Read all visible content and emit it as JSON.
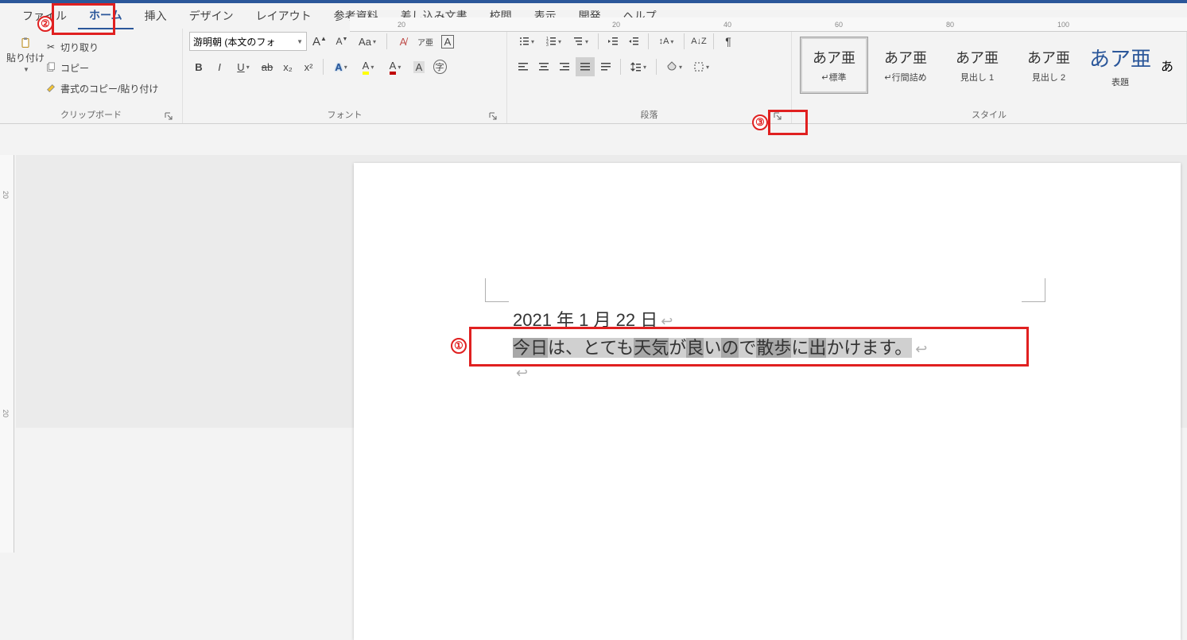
{
  "tabs": {
    "file": "ファイル",
    "home": "ホーム",
    "insert": "挿入",
    "design": "デザイン",
    "layout": "レイアウト",
    "references": "参考資料",
    "mailings": "差し込み文書",
    "review": "校閲",
    "view": "表示",
    "developer": "開発",
    "help": "ヘルプ"
  },
  "clipboard": {
    "paste": "貼り付け",
    "cut": "切り取り",
    "copy": "コピー",
    "format_painter": "書式のコピー/貼り付け",
    "group_label": "クリップボード"
  },
  "font": {
    "name": "游明朝 (本文のフォ",
    "group_label": "フォント",
    "increase": "A",
    "decrease": "A",
    "aa": "Aa",
    "ruby": "ア亜",
    "bold": "B",
    "italic": "I",
    "underline": "U",
    "strike": "ab",
    "sub": "x₂",
    "sup": "x²",
    "text_effects": "A",
    "highlight": "A",
    "font_color": "A",
    "char_shading": "A",
    "enclose": "字"
  },
  "paragraph": {
    "group_label": "段落"
  },
  "styles": {
    "group_label": "スタイル",
    "items": [
      {
        "preview": "あア亜",
        "name": "↵標準",
        "sel": true
      },
      {
        "preview": "あア亜",
        "name": "↵行間詰め"
      },
      {
        "preview": "あア亜",
        "name": "見出し 1"
      },
      {
        "preview": "あア亜",
        "name": "見出し 2"
      },
      {
        "preview": "あア亜",
        "name": "表題",
        "big": true
      }
    ],
    "more": "あ"
  },
  "ruler": {
    "h": [
      "20",
      "20",
      "40",
      "60",
      "80",
      "100"
    ],
    "v": [
      "20",
      "20"
    ]
  },
  "document": {
    "line1": "2021 年 1 月 22 日",
    "line2_segs": [
      {
        "t": "今日",
        "d": true
      },
      {
        "t": "は、とても",
        "d": false
      },
      {
        "t": "天気",
        "d": true
      },
      {
        "t": "が",
        "d": false
      },
      {
        "t": "良",
        "d": true
      },
      {
        "t": "い",
        "d": false
      },
      {
        "t": "の",
        "d": true
      },
      {
        "t": "で",
        "d": false
      },
      {
        "t": "散歩",
        "d": true
      },
      {
        "t": "に",
        "d": false
      },
      {
        "t": "出",
        "d": true
      },
      {
        "t": "かけます。",
        "d": false
      }
    ]
  },
  "callouts": {
    "c1": "①",
    "c2": "②",
    "c3": "③"
  }
}
